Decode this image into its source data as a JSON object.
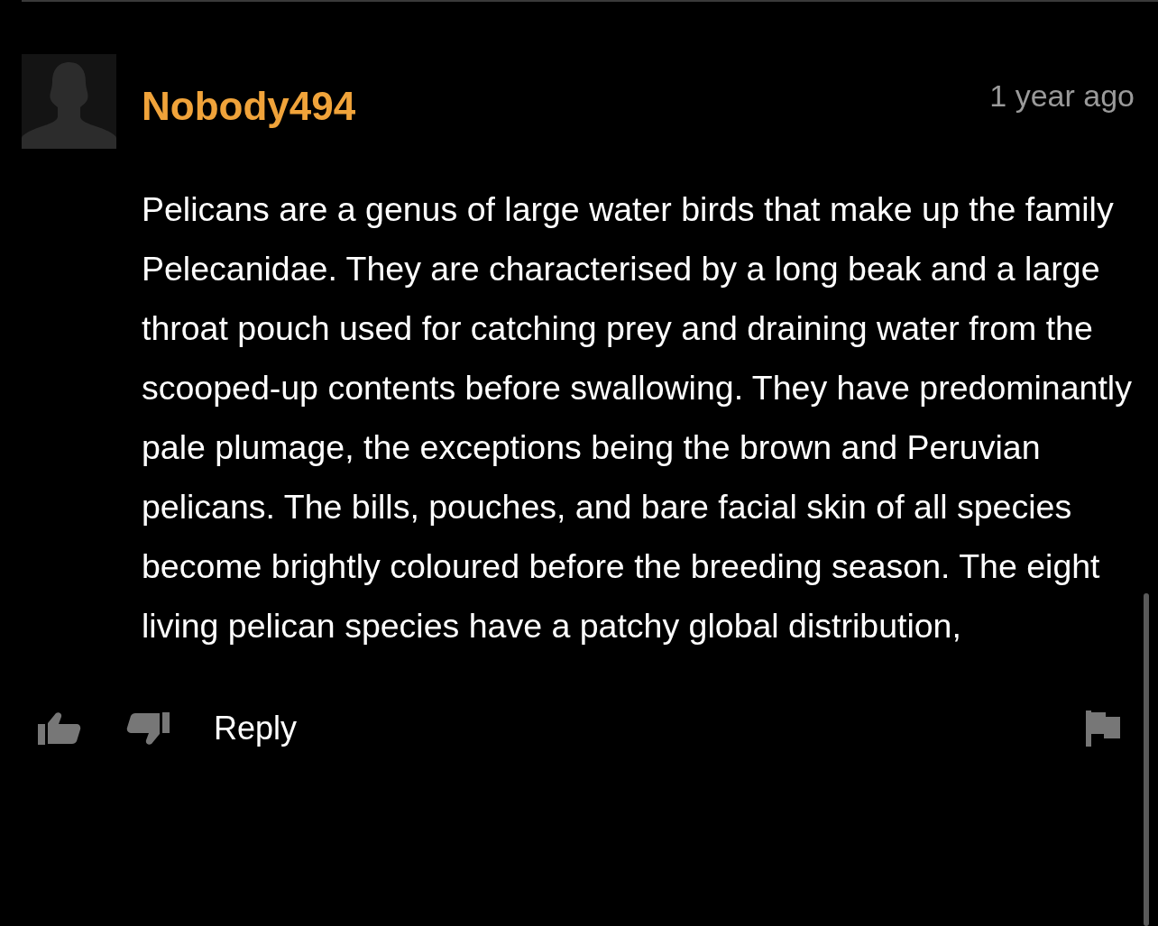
{
  "comment": {
    "username": "Nobody494",
    "time": "1 year ago",
    "body": "Pelicans are a genus of large water birds that make up the family Pelecanidae. They are characterised by a long beak and a large throat pouch used for catching prey and draining water from the scooped-up contents before swallowing. They have predominantly pale plumage, the exceptions being the brown and Peruvian pelicans. The bills, pouches, and bare facial skin of all species become brightly coloured before the breeding season. The eight living pelican species have a patchy global distribution,",
    "reply_label": "Reply"
  }
}
